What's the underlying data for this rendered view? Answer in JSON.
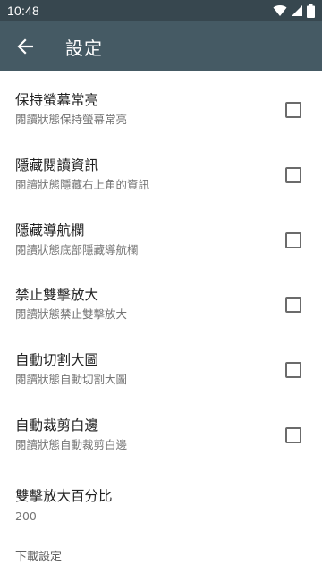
{
  "status_bar": {
    "time": "10:48",
    "icons": [
      "wifi-icon",
      "signal-icon",
      "battery-icon"
    ]
  },
  "app_bar": {
    "back_icon": "arrow-left-icon",
    "title": "設定"
  },
  "preferences": [
    {
      "title": "保持螢幕常亮",
      "summary": "閱讀狀態保持螢幕常亮",
      "checked": false
    },
    {
      "title": "隱藏閱讀資訊",
      "summary": "閱讀狀態隱藏右上角的資訊",
      "checked": false
    },
    {
      "title": "隱藏導航欄",
      "summary": "閱讀狀態底部隱藏導航欄",
      "checked": false
    },
    {
      "title": "禁止雙擊放大",
      "summary": "閱讀狀態禁止雙擊放大",
      "checked": false
    },
    {
      "title": "自動切割大圖",
      "summary": "閱讀狀態自動切割大圖",
      "checked": false
    },
    {
      "title": "自動裁剪白邊",
      "summary": "閱讀狀態自動裁剪白邊",
      "checked": false
    }
  ],
  "zoom_pref": {
    "title": "雙擊放大百分比",
    "value": "200"
  },
  "download_section": {
    "label": "下載設定"
  },
  "colors": {
    "status_bar": "#37474f",
    "app_bar": "#455a64",
    "checkbox_border": "#6b6b6b"
  }
}
